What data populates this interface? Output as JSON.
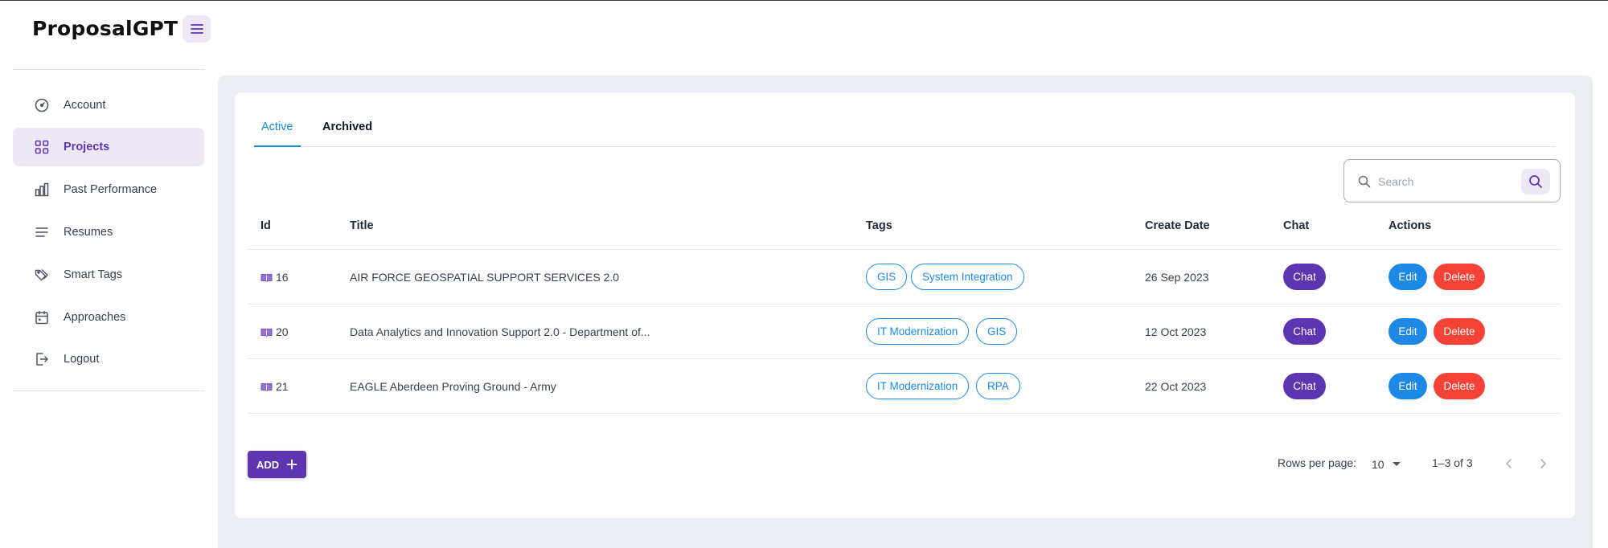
{
  "app": {
    "title": "ProposalGPT"
  },
  "sidebar": {
    "items": [
      {
        "label": "Account",
        "icon": "gauge-icon",
        "active": false
      },
      {
        "label": "Projects",
        "icon": "grid-icon",
        "active": true
      },
      {
        "label": "Past Performance",
        "icon": "bar-chart-icon",
        "active": false
      },
      {
        "label": "Resumes",
        "icon": "list-icon",
        "active": false
      },
      {
        "label": "Smart Tags",
        "icon": "tags-icon",
        "active": false
      },
      {
        "label": "Approaches",
        "icon": "calendar-icon",
        "active": false
      },
      {
        "label": "Logout",
        "icon": "logout-icon",
        "active": false
      }
    ]
  },
  "tabs": [
    {
      "label": "Active",
      "selected": true
    },
    {
      "label": "Archived",
      "selected": false
    }
  ],
  "search": {
    "placeholder": "Search",
    "value": ""
  },
  "table": {
    "columns": [
      "Id",
      "Title",
      "Tags",
      "Create Date",
      "Chat",
      "Actions"
    ],
    "rows": [
      {
        "id": "16",
        "title": "AIR FORCE GEOSPATIAL SUPPORT SERVICES 2.0",
        "tags": [
          "GIS",
          "System Integration"
        ],
        "create_date": "26 Sep 2023",
        "chat_label": "Chat",
        "edit_label": "Edit",
        "delete_label": "Delete"
      },
      {
        "id": "20",
        "title": "Data Analytics and Innovation Support 2.0 - Department of...",
        "tags": [
          "IT Modernization",
          "GIS"
        ],
        "create_date": "12 Oct 2023",
        "chat_label": "Chat",
        "edit_label": "Edit",
        "delete_label": "Delete"
      },
      {
        "id": "21",
        "title": "EAGLE Aberdeen Proving Ground - Army",
        "tags": [
          "IT Modernization",
          "RPA"
        ],
        "create_date": "22 Oct 2023",
        "chat_label": "Chat",
        "edit_label": "Edit",
        "delete_label": "Delete"
      }
    ]
  },
  "footer": {
    "add_label": "ADD",
    "rows_per_page_label": "Rows per page:",
    "rows_per_page_value": "10",
    "pagination_info": "1–3 of 3"
  },
  "colors": {
    "primary_purple": "#5e35b1",
    "light_purple": "#ede7f6",
    "blue": "#1e88e5",
    "red": "#f44336",
    "main_bg": "#ebeef3"
  }
}
